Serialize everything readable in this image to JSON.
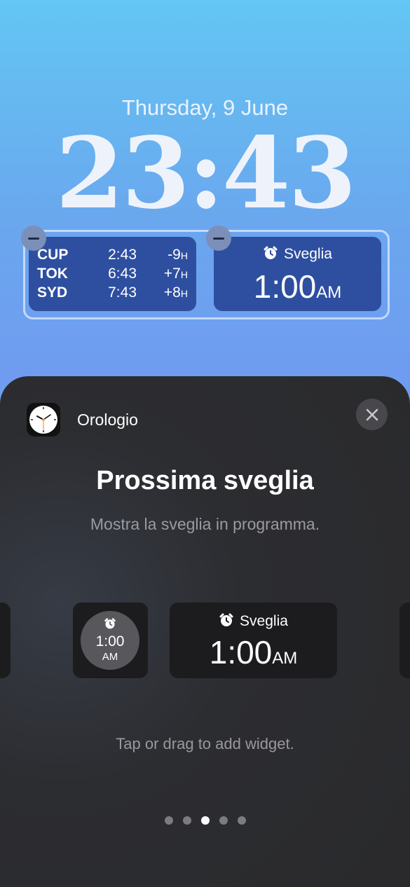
{
  "lockscreen": {
    "date": "Thursday, 9 June",
    "time": "23:43"
  },
  "world_clock_widget": {
    "rows": [
      {
        "city": "CUP",
        "time": "2:43",
        "offset": "-9",
        "unit": "H"
      },
      {
        "city": "TOK",
        "time": "6:43",
        "offset": "+7",
        "unit": "H"
      },
      {
        "city": "SYD",
        "time": "7:43",
        "offset": "+8",
        "unit": "H"
      }
    ]
  },
  "alarm_widget": {
    "label": "Sveglia",
    "time": "1:00",
    "ampm": "AM",
    "icon": "alarm-clock-icon"
  },
  "sheet": {
    "app_name": "Orologio",
    "app_icon": "clock-app-icon",
    "title": "Prossima sveglia",
    "subtitle": "Mostra la sveglia in programma.",
    "small_widget": {
      "time": "1:00",
      "ampm": "AM"
    },
    "medium_widget": {
      "label": "Sveglia",
      "time": "1:00",
      "ampm": "AM"
    },
    "hint": "Tap or drag to add widget.",
    "page_count": 5,
    "current_page": 3
  },
  "colors": {
    "widget_bg": "#2e4fa0",
    "sheet_bg": "#2c2d31",
    "card_bg": "#1c1c1e"
  }
}
